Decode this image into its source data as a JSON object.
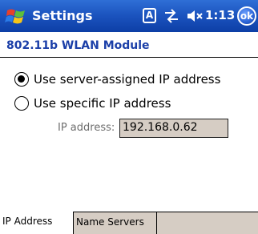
{
  "titlebar": {
    "start_icon": "windows-flag-icon",
    "title": "Settings",
    "input_mode": "A",
    "connectivity_icon": "connectivity-arrows-icon",
    "speaker_icon": "speaker-muted-icon",
    "time": "1:13",
    "ok_label": "ok"
  },
  "page": {
    "title": "802.11b WLAN Module"
  },
  "options": [
    {
      "label": "Use server-assigned IP address",
      "selected": true
    },
    {
      "label": "Use specific IP address",
      "selected": false
    }
  ],
  "ip": {
    "label": "IP address:",
    "value": "192.168.0.62"
  },
  "tabs": [
    {
      "label": "IP Address",
      "active": true
    },
    {
      "label": "Name Servers",
      "active": false
    }
  ],
  "colors": {
    "titlebar": "#1c55c0",
    "section_title": "#1b3fa8",
    "disabled_field": "#d6cdc4"
  }
}
